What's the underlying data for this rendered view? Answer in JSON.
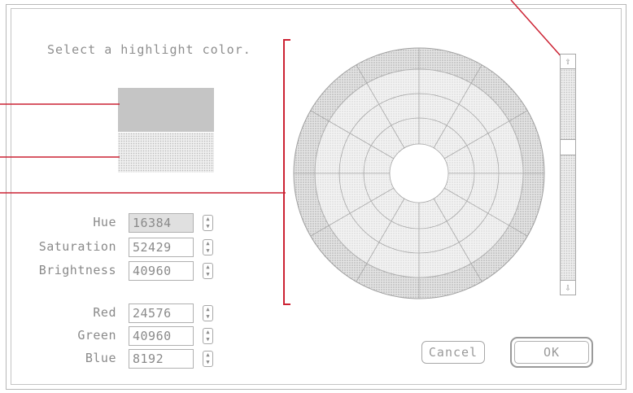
{
  "dialog": {
    "prompt": "Select a highlight color."
  },
  "hsb": {
    "hue_label": "Hue",
    "hue_value": "16384",
    "saturation_label": "Saturation",
    "saturation_value": "52429",
    "brightness_label": "Brightness",
    "brightness_value": "40960"
  },
  "rgb": {
    "red_label": "Red",
    "red_value": "24576",
    "green_label": "Green",
    "green_value": "40960",
    "blue_label": "Blue",
    "blue_value": "8192"
  },
  "stepper_icons": {
    "up": "▲",
    "down": "▼"
  },
  "scrollbar": {
    "up_arrow": "⇧",
    "down_arrow": "⇩"
  },
  "buttons": {
    "cancel": "Cancel",
    "ok": "OK"
  },
  "colors": {
    "callout": "#cc2233",
    "wheel_outer": "#d4d4d4",
    "wheel_inner": "#ededed"
  }
}
